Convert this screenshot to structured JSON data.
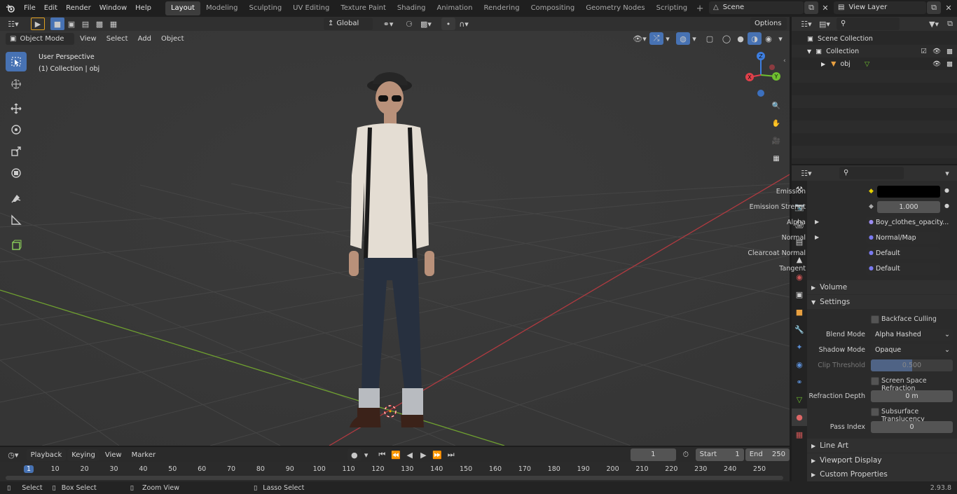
{
  "topbar": {
    "menus": [
      "File",
      "Edit",
      "Render",
      "Window",
      "Help"
    ],
    "workspaces": [
      "Layout",
      "Modeling",
      "Sculpting",
      "UV Editing",
      "Texture Paint",
      "Shading",
      "Animation",
      "Rendering",
      "Compositing",
      "Geometry Nodes",
      "Scripting"
    ],
    "active_workspace": "Layout",
    "scene_name": "Scene",
    "view_layer": "View Layer"
  },
  "viewport_header": {
    "mode": "Object Mode",
    "menus": [
      "View",
      "Select",
      "Add",
      "Object"
    ],
    "orientation": "Global",
    "options": "Options"
  },
  "viewport": {
    "title": "User Perspective",
    "subtitle": "(1) Collection | obj"
  },
  "gizmo": {
    "x": "X",
    "y": "Y",
    "z": "Z"
  },
  "outliner": {
    "scene_collection": "Scene Collection",
    "collection": "Collection",
    "object": "obj"
  },
  "properties": {
    "rows": [
      {
        "label": "Emission",
        "value": ""
      },
      {
        "label": "Emission Strengt",
        "value": "1.000"
      },
      {
        "label": "Alpha",
        "value": "Boy_clothes_opacity..."
      },
      {
        "label": "Normal",
        "value": "Normal/Map"
      },
      {
        "label": "Clearcoat Normal",
        "value": "Default"
      },
      {
        "label": "Tangent",
        "value": "Default"
      }
    ],
    "volume": "Volume",
    "settings": "Settings",
    "backface_culling": "Backface Culling",
    "blend_mode_label": "Blend Mode",
    "blend_mode": "Alpha Hashed",
    "shadow_mode_label": "Shadow Mode",
    "shadow_mode": "Opaque",
    "clip_threshold_label": "Clip Threshold",
    "clip_threshold": "0.500",
    "clip_threshold_fraction": 0.5,
    "ssr": "Screen Space Refraction",
    "refraction_depth_label": "Refraction Depth",
    "refraction_depth": "0 m",
    "subsurface": "Subsurface Translucency",
    "pass_index_label": "Pass Index",
    "pass_index": "0",
    "line_art": "Line Art",
    "viewport_display": "Viewport Display",
    "custom_properties": "Custom Properties"
  },
  "timeline": {
    "menus": [
      "Playback",
      "Keying",
      "View",
      "Marker"
    ],
    "current_frame": "1",
    "start_label": "Start",
    "start": "1",
    "end_label": "End",
    "end": "250",
    "ticks": [
      "1",
      "10",
      "20",
      "30",
      "40",
      "50",
      "60",
      "70",
      "80",
      "90",
      "100",
      "110",
      "120",
      "130",
      "140",
      "150",
      "160",
      "170",
      "180",
      "190",
      "200",
      "210",
      "220",
      "230",
      "240",
      "250"
    ]
  },
  "statusbar": {
    "select": "Select",
    "box_select": "Box Select",
    "zoom_view": "Zoom View",
    "lasso_select": "Lasso Select",
    "version": "2.93.8"
  },
  "colors": {
    "accent": "#4772b3",
    "x_axis": "#e0404a",
    "y_axis": "#6fbf2f",
    "z_axis": "#3d7ee0"
  }
}
